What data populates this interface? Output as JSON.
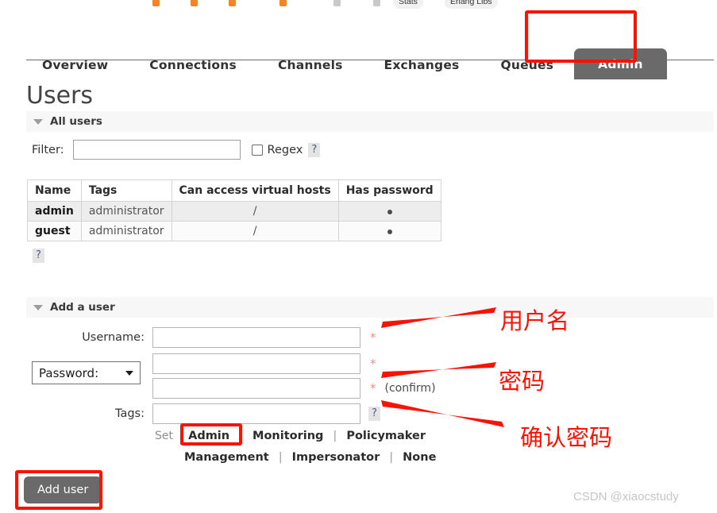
{
  "browser": {
    "bookmarks": [
      {
        "label": "Stats"
      },
      {
        "label": "Erlang Libs"
      }
    ]
  },
  "nav": {
    "items": [
      {
        "label": "Overview",
        "active": false
      },
      {
        "label": "Connections",
        "active": false
      },
      {
        "label": "Channels",
        "active": false
      },
      {
        "label": "Exchanges",
        "active": false
      },
      {
        "label": "Queues",
        "active": false
      },
      {
        "label": "Admin",
        "active": true
      }
    ]
  },
  "page": {
    "title": "Users"
  },
  "all_users_section": {
    "header": "All users",
    "filter_label": "Filter:",
    "filter_value": "",
    "filter_placeholder": "",
    "regex_label": "Regex",
    "regex_checked": false,
    "regex_help": "?",
    "table_help": "?",
    "columns": [
      "Name",
      "Tags",
      "Can access virtual hosts",
      "Has password"
    ],
    "rows": [
      {
        "name": "admin",
        "tags": "administrator",
        "vhosts": "/",
        "has_password": "●"
      },
      {
        "name": "guest",
        "tags": "administrator",
        "vhosts": "/",
        "has_password": "●"
      }
    ]
  },
  "add_user_section": {
    "header": "Add a user",
    "username_label": "Username:",
    "username_value": "",
    "password_select_label": "Password:",
    "password_value": "",
    "password_confirm_value": "",
    "confirm_label": "(confirm)",
    "required_marker": "*",
    "tags_label": "Tags:",
    "tags_value": "",
    "tags_help": "?",
    "set_label": "Set",
    "tag_presets_row1": [
      "Admin",
      "Monitoring",
      "Policymaker"
    ],
    "tag_presets_row2": [
      "Management",
      "Impersonator",
      "None"
    ],
    "separator": "|",
    "submit_label": "Add user"
  },
  "annotations": {
    "username_cn": "用户名",
    "password_cn": "密码",
    "confirm_cn": "确认密码",
    "color": "#fb1203"
  },
  "watermark": {
    "text": "CSDN @xiaocstudy"
  }
}
